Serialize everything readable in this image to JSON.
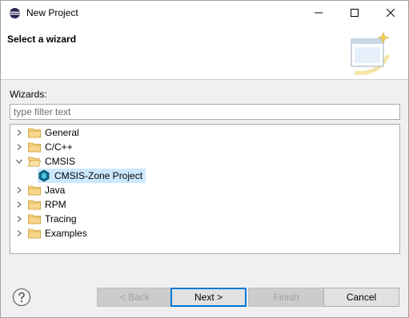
{
  "window": {
    "title": "New Project"
  },
  "banner": {
    "title": "Select a wizard"
  },
  "wizards": {
    "label": "Wizards:",
    "filter_placeholder": "type filter text",
    "tree": [
      {
        "label": "General",
        "expanded": false,
        "level": 0,
        "type": "folder"
      },
      {
        "label": "C/C++",
        "expanded": false,
        "level": 0,
        "type": "folder"
      },
      {
        "label": "CMSIS",
        "expanded": true,
        "level": 0,
        "type": "folder"
      },
      {
        "label": "CMSIS-Zone Project",
        "level": 1,
        "type": "item",
        "selected": true
      },
      {
        "label": "Java",
        "expanded": false,
        "level": 0,
        "type": "folder"
      },
      {
        "label": "RPM",
        "expanded": false,
        "level": 0,
        "type": "folder"
      },
      {
        "label": "Tracing",
        "expanded": false,
        "level": 0,
        "type": "folder"
      },
      {
        "label": "Examples",
        "expanded": false,
        "level": 0,
        "type": "folder"
      }
    ]
  },
  "buttons": {
    "back": "< Back",
    "next": "Next >",
    "finish": "Finish",
    "cancel": "Cancel"
  },
  "colors": {
    "selection": "#cce8ff",
    "folder": "#e8b23a",
    "default_button_border": "#0078d7"
  }
}
